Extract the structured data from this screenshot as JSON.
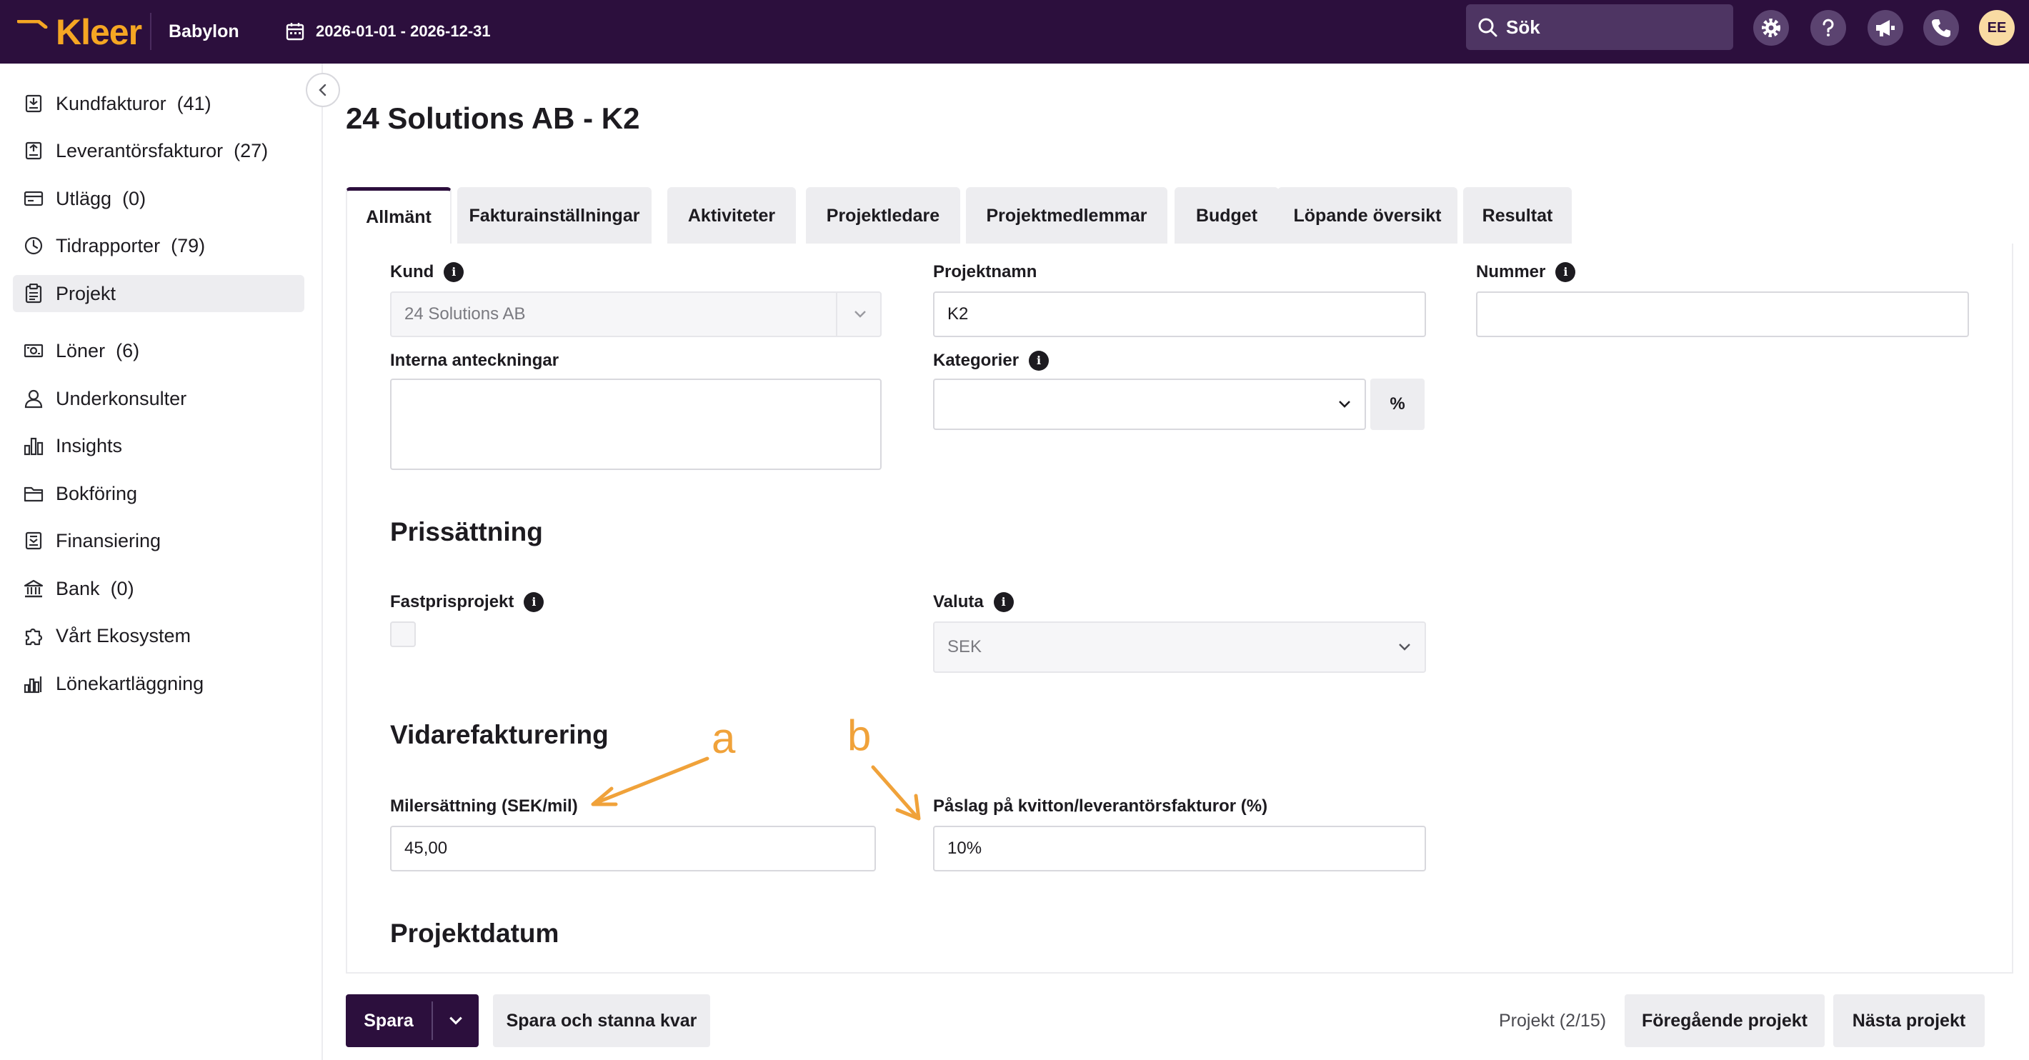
{
  "app": {
    "logo_text": "Kleer",
    "company": "Babylon",
    "date_range": "2026-01-01 - 2026-12-31",
    "search_placeholder": "Sök",
    "avatar_initials": "EE",
    "brand_color": "#2c0f3d",
    "accent_color": "#f5a623"
  },
  "sidebar": {
    "items": [
      {
        "label": "Kundfakturor",
        "count": "(41)",
        "icon": "invoice-in-icon"
      },
      {
        "label": "Leverantörsfakturor",
        "count": "(27)",
        "icon": "invoice-out-icon"
      },
      {
        "label": "Utlägg",
        "count": "(0)",
        "icon": "card-icon"
      },
      {
        "label": "Tidrapporter",
        "count": "(79)",
        "icon": "clock-icon"
      },
      {
        "label": "Projekt",
        "count": "",
        "icon": "clipboard-icon"
      },
      {
        "label": "Löner",
        "count": "(6)",
        "icon": "money-icon"
      },
      {
        "label": "Underkonsulter",
        "count": "",
        "icon": "person-icon"
      },
      {
        "label": "Insights",
        "count": "",
        "icon": "bar-chart-icon"
      },
      {
        "label": "Bokföring",
        "count": "",
        "icon": "folder-icon"
      },
      {
        "label": "Finansiering",
        "count": "",
        "icon": "finance-icon"
      },
      {
        "label": "Bank",
        "count": "(0)",
        "icon": "bank-icon"
      },
      {
        "label": "Vårt Ekosystem",
        "count": "",
        "icon": "puzzle-icon"
      },
      {
        "label": "Lönekartläggning",
        "count": "",
        "icon": "chart-icon"
      }
    ]
  },
  "page": {
    "title": "24 Solutions AB - K2"
  },
  "tabs": [
    {
      "label": "Allmänt"
    },
    {
      "label": "Fakturainställningar"
    },
    {
      "label": "Aktiviteter"
    },
    {
      "label": "Projektledare"
    },
    {
      "label": "Projektmedlemmar"
    },
    {
      "label": "Budget"
    },
    {
      "label": "Löpande översikt"
    },
    {
      "label": "Resultat"
    }
  ],
  "form": {
    "kund_label": "Kund",
    "kund_value": "24 Solutions AB",
    "projektnamn_label": "Projektnamn",
    "projektnamn_value": "K2",
    "nummer_label": "Nummer",
    "nummer_value": "",
    "interna_label": "Interna anteckningar",
    "kategorier_label": "Kategorier",
    "kategorier_value": "",
    "pct_button": "%",
    "pris_section": "Prissättning",
    "fastpris_label": "Fastprisprojekt",
    "valuta_label": "Valuta",
    "valuta_value": "SEK",
    "vidare_section": "Vidarefakturering",
    "miler_label": "Milersättning (SEK/mil)",
    "miler_value": "45,00",
    "paslag_label": "Påslag på kvitton/leverantörsfakturor (%)",
    "paslag_value": "10%",
    "datum_section": "Projektdatum"
  },
  "annotations": {
    "a": "a",
    "b": "b",
    "color": "#f0a23a"
  },
  "footer": {
    "save": "Spara",
    "save_stay": "Spara och stanna kvar",
    "project_count": "Projekt (2/15)",
    "prev": "Föregående projekt",
    "next": "Nästa projekt"
  }
}
